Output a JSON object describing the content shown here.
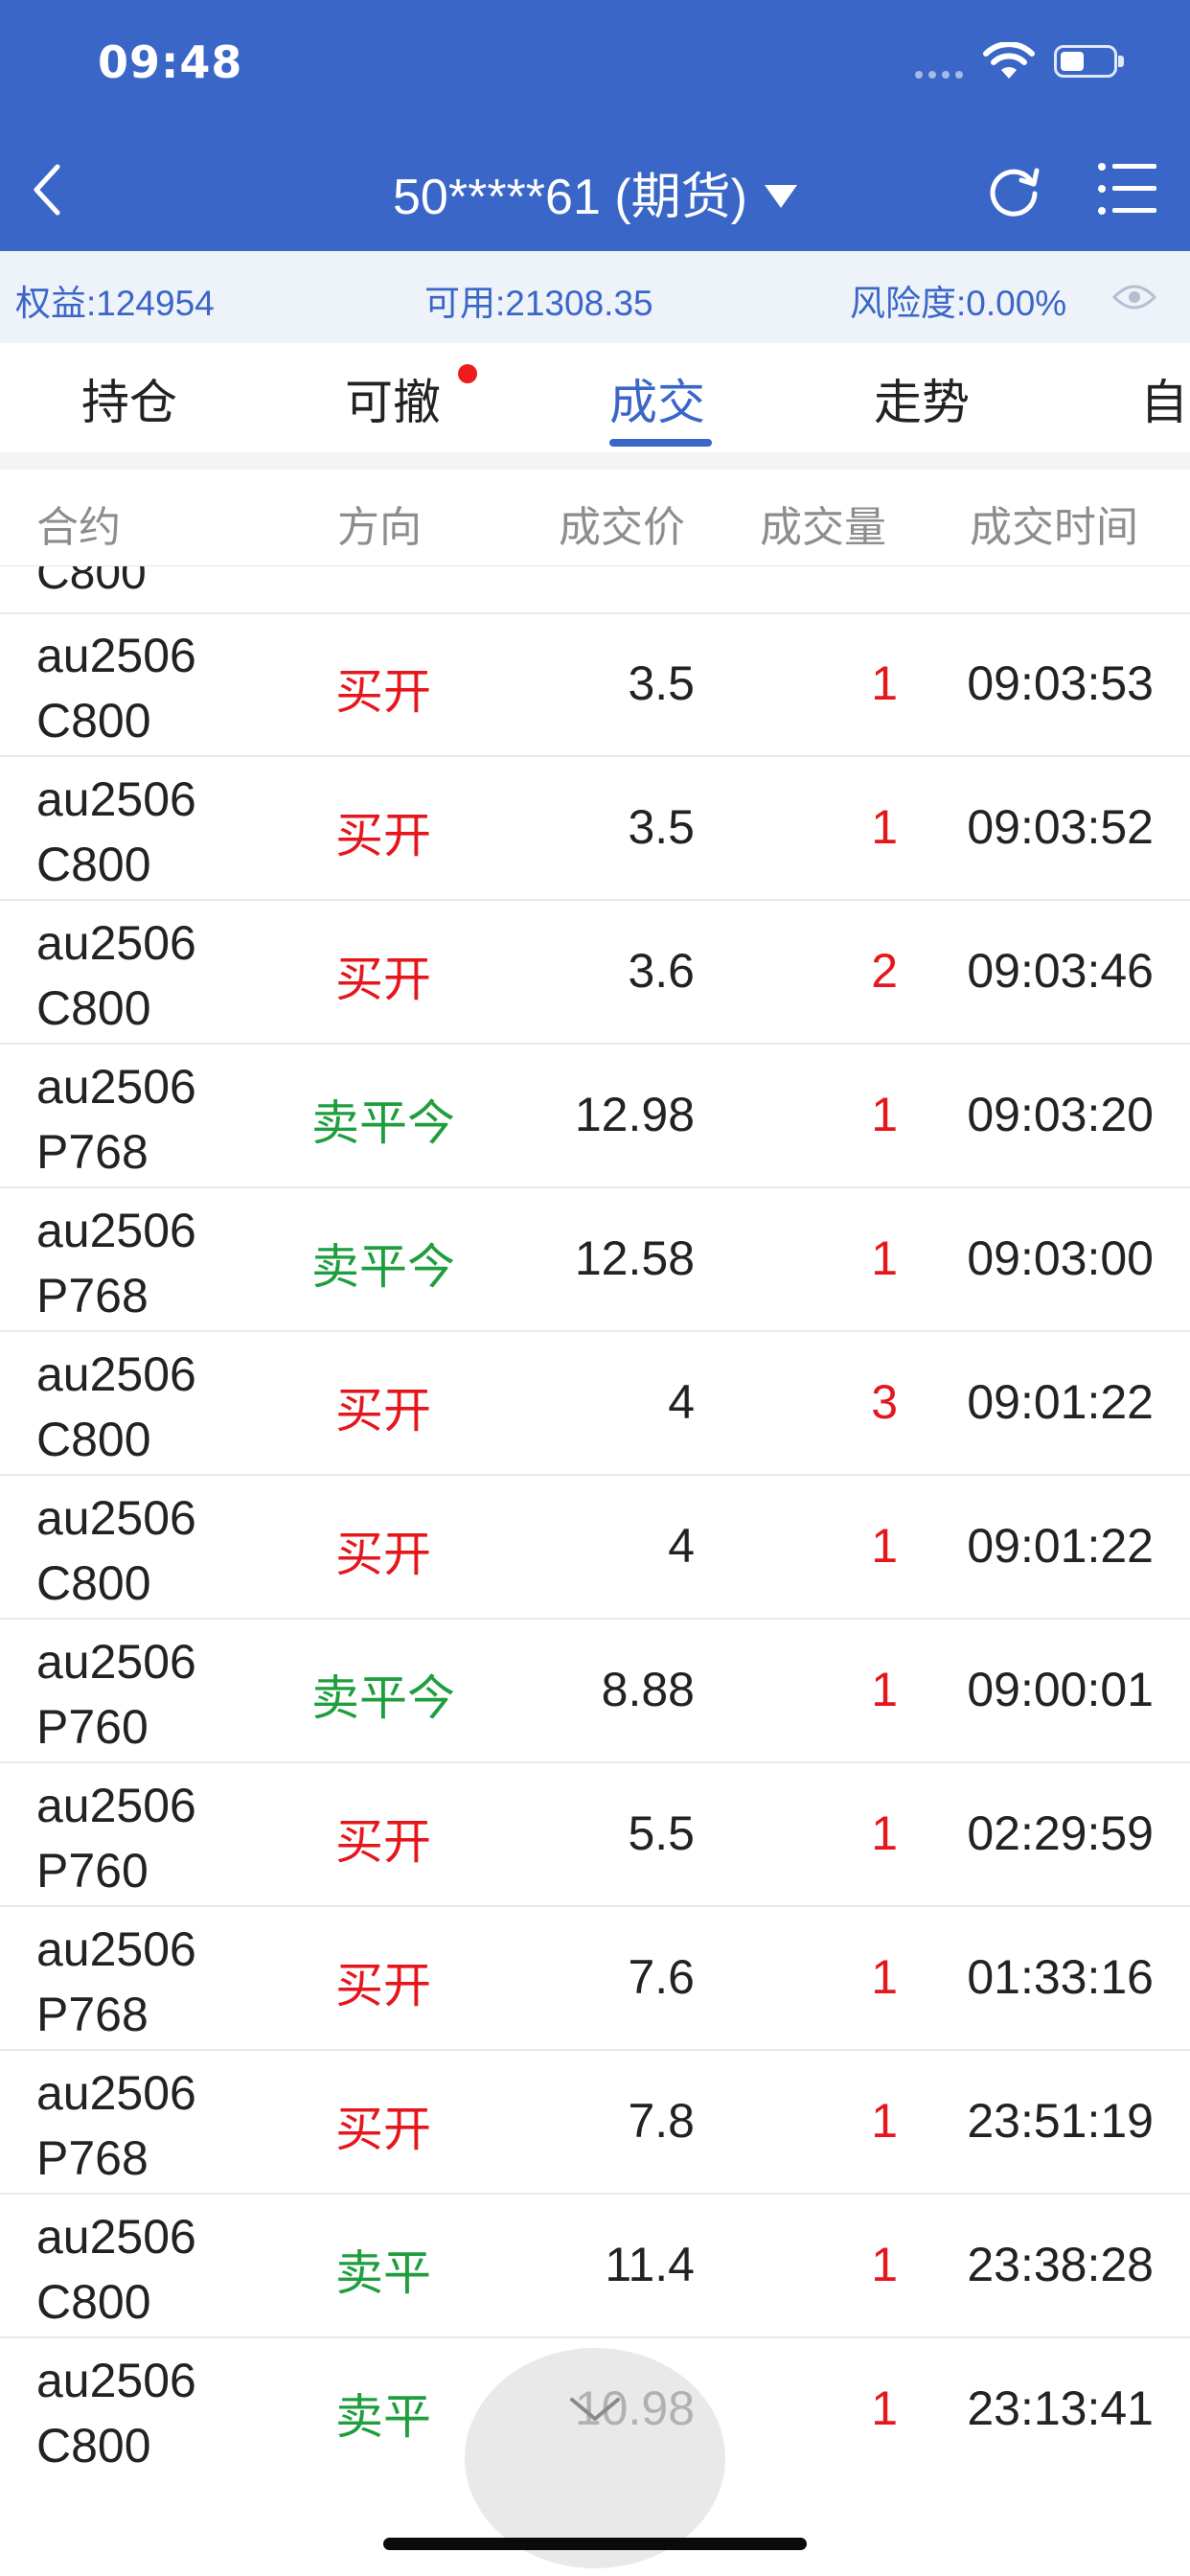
{
  "status_bar": {
    "time": "09:48"
  },
  "header": {
    "account": "50*****61 (期货)"
  },
  "info": {
    "equity": "权益:124954",
    "available": "可用:21308.35",
    "risk": "风险度:0.00%"
  },
  "tabs": [
    {
      "label": "持仓"
    },
    {
      "label": "可撤"
    },
    {
      "label": "成交"
    },
    {
      "label": "走势"
    },
    {
      "label": "自"
    }
  ],
  "table": {
    "headers": [
      "合约",
      "方向",
      "成交价",
      "成交量",
      "成交时间"
    ],
    "partial_row_contract": "C800",
    "rows": [
      {
        "contract_l1": "au2506",
        "contract_l2": "C800",
        "direction": "买开",
        "price": "3.5",
        "qty": "1",
        "time": "09:03:53"
      },
      {
        "contract_l1": "au2506",
        "contract_l2": "C800",
        "direction": "买开",
        "price": "3.5",
        "qty": "1",
        "time": "09:03:52"
      },
      {
        "contract_l1": "au2506",
        "contract_l2": "C800",
        "direction": "买开",
        "price": "3.6",
        "qty": "2",
        "time": "09:03:46"
      },
      {
        "contract_l1": "au2506",
        "contract_l2": "P768",
        "direction": "卖平今",
        "price": "12.98",
        "qty": "1",
        "time": "09:03:20"
      },
      {
        "contract_l1": "au2506",
        "contract_l2": "P768",
        "direction": "卖平今",
        "price": "12.58",
        "qty": "1",
        "time": "09:03:00"
      },
      {
        "contract_l1": "au2506",
        "contract_l2": "C800",
        "direction": "买开",
        "price": "4",
        "qty": "3",
        "time": "09:01:22"
      },
      {
        "contract_l1": "au2506",
        "contract_l2": "C800",
        "direction": "买开",
        "price": "4",
        "qty": "1",
        "time": "09:01:22"
      },
      {
        "contract_l1": "au2506",
        "contract_l2": "P760",
        "direction": "卖平今",
        "price": "8.88",
        "qty": "1",
        "time": "09:00:01"
      },
      {
        "contract_l1": "au2506",
        "contract_l2": "P760",
        "direction": "买开",
        "price": "5.5",
        "qty": "1",
        "time": "02:29:59"
      },
      {
        "contract_l1": "au2506",
        "contract_l2": "P768",
        "direction": "买开",
        "price": "7.6",
        "qty": "1",
        "time": "01:33:16"
      },
      {
        "contract_l1": "au2506",
        "contract_l2": "P768",
        "direction": "买开",
        "price": "7.8",
        "qty": "1",
        "time": "23:51:19"
      },
      {
        "contract_l1": "au2506",
        "contract_l2": "C800",
        "direction": "卖平",
        "price": "11.4",
        "qty": "1",
        "time": "23:38:28"
      },
      {
        "contract_l1": "au2506",
        "contract_l2": "C800",
        "direction": "卖平",
        "price": "10.98",
        "qty": "1",
        "time": "23:13:41"
      }
    ]
  },
  "colors": {
    "brand": "#3a66c8",
    "buy": "#e5161c",
    "sell": "#1e9e3c"
  }
}
